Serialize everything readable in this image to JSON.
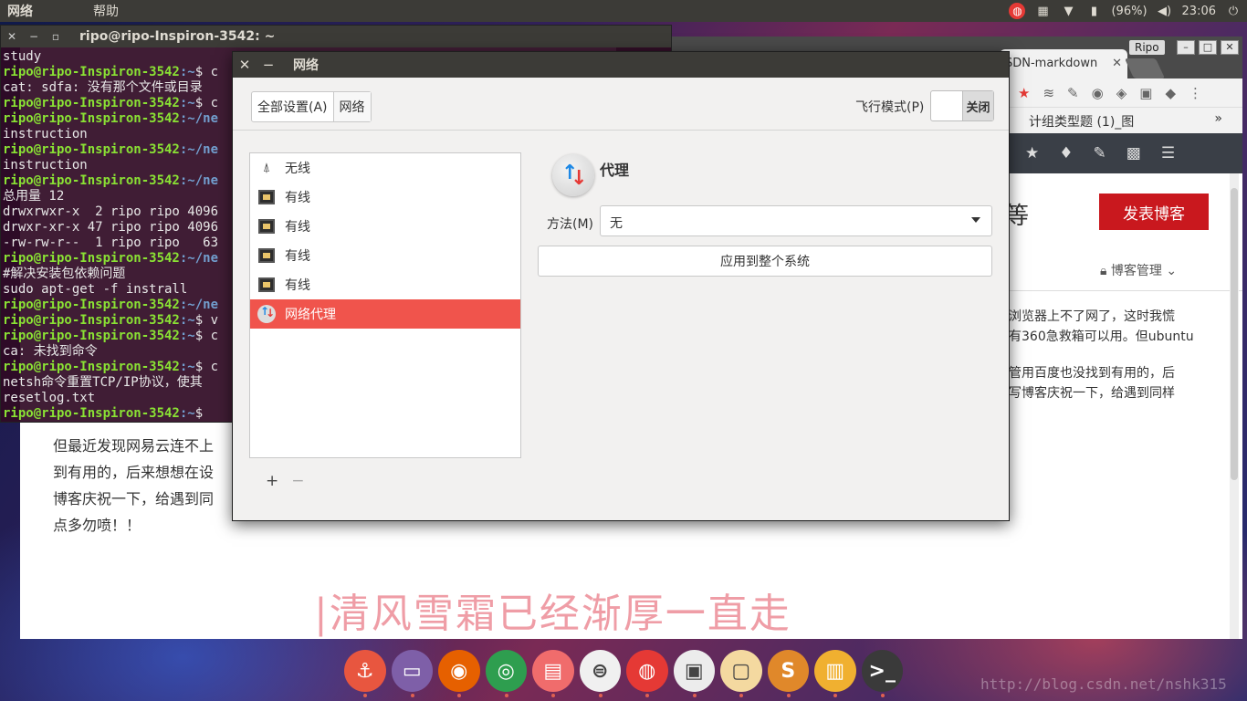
{
  "top_panel": {
    "menus": [
      "网络",
      "帮助"
    ],
    "tray": {
      "battery": "(96%)",
      "time": "23:06"
    }
  },
  "browser": {
    "tab_label": "SDN-markdown",
    "tab_close": "✕",
    "user_label": "Ripo",
    "bookmark": "计组类型题 (1)_图",
    "bookmark_more": "»",
    "title_fragment": "等",
    "publish_button": "发表博客",
    "manage_label": "博客管理",
    "text_p1": "浏览器上不了网了，这时我慌\n有360急救箱可以用。但ubuntu",
    "text_p2": "管用百度也没找到有用的，后\n写博客庆祝一下，给遇到同样"
  },
  "editor": {
    "lines": [
      "但最近发现网易云连不上",
      "到有用的，后来想想在设",
      "博客庆祝一下，给遇到同",
      "点多勿喷！！"
    ]
  },
  "terminal": {
    "title": "ripo@ripo-Inspiron-3542: ~",
    "prompt": "ripo@ripo-Inspiron-3542",
    "lines": [
      {
        "t": "study"
      },
      {
        "p": true,
        "d": "~",
        "c": "$ c"
      },
      {
        "t": "cat: sdfa: 没有那个文件或目录"
      },
      {
        "p": true,
        "d": "~",
        "c": "$ c"
      },
      {
        "p": true,
        "d": "~/ne",
        "c": ""
      },
      {
        "t": "instruction"
      },
      {
        "p": true,
        "d": "~/ne",
        "c": ""
      },
      {
        "t": "instruction"
      },
      {
        "p": true,
        "d": "~/ne",
        "c": ""
      },
      {
        "t": "总用量 12"
      },
      {
        "t": "drwxrwxr-x  2 ripo ripo 4096"
      },
      {
        "t": "drwxr-xr-x 47 ripo ripo 4096"
      },
      {
        "t": "-rw-rw-r--  1 ripo ripo   63"
      },
      {
        "p": true,
        "d": "~/ne",
        "c": ""
      },
      {
        "t": "#解决安装包依赖问题"
      },
      {
        "t": "sudo apt-get -f instrall"
      },
      {
        "p": true,
        "d": "~/ne",
        "c": ""
      },
      {
        "p": true,
        "d": "~",
        "c": "$ v"
      },
      {
        "p": true,
        "d": "~",
        "c": "$ c"
      },
      {
        "t": "ca: 未找到命令"
      },
      {
        "p": true,
        "d": "~",
        "c": "$ c"
      },
      {
        "t": "netsh命令重置TCP/IP协议，使其"
      },
      {
        "t": "resetlog.txt"
      },
      {
        "p": true,
        "d": "~",
        "c": "$ "
      }
    ]
  },
  "dialog": {
    "title": "网络",
    "crumb_all": "全部设置(A)",
    "crumb_net": "网络",
    "airplane_label": "飞行模式(P)",
    "airplane_state": "关闭",
    "items": [
      {
        "label": "无线",
        "icon": "wifi-icon"
      },
      {
        "label": "有线",
        "icon": "ethernet-icon"
      },
      {
        "label": "有线",
        "icon": "ethernet-icon"
      },
      {
        "label": "有线",
        "icon": "ethernet-icon"
      },
      {
        "label": "有线",
        "icon": "ethernet-icon"
      },
      {
        "label": "网络代理",
        "icon": "proxy-icon",
        "selected": true
      }
    ],
    "add": "+",
    "remove": "−",
    "panel_title": "代理",
    "method_label": "方法(M)",
    "method_value": "无",
    "apply_button": "应用到整个系统"
  },
  "overlay_text": "|清风雪霜已经渐厚一直走",
  "watermark": "http://blog.csdn.net/nshk315",
  "dock": [
    {
      "name": "anchor-app",
      "glyph": "⚓",
      "color": "#e8563f"
    },
    {
      "name": "files-app",
      "glyph": "▭",
      "color": "#7e5fa8"
    },
    {
      "name": "firefox-app",
      "glyph": "◉",
      "color": "#e66000"
    },
    {
      "name": "chrome-app",
      "glyph": "◎",
      "color": "#2e9e4f"
    },
    {
      "name": "notes-app",
      "glyph": "▤",
      "color": "#f06c6c"
    },
    {
      "name": "settings-toggle-app",
      "glyph": "⊜",
      "color": "#f0f0f0"
    },
    {
      "name": "netease-music-app",
      "glyph": "◍",
      "color": "#e53935"
    },
    {
      "name": "remote-desktop-app",
      "glyph": "▣",
      "color": "#ececec"
    },
    {
      "name": "layout-app",
      "glyph": "▢",
      "color": "#f4d9a0"
    },
    {
      "name": "s-app",
      "glyph": "S",
      "color": "#e0882a"
    },
    {
      "name": "software-center-app",
      "glyph": "▥",
      "color": "#f0b030"
    },
    {
      "name": "terminal-app",
      "glyph": ">_",
      "color": "#3a3a3a"
    }
  ]
}
